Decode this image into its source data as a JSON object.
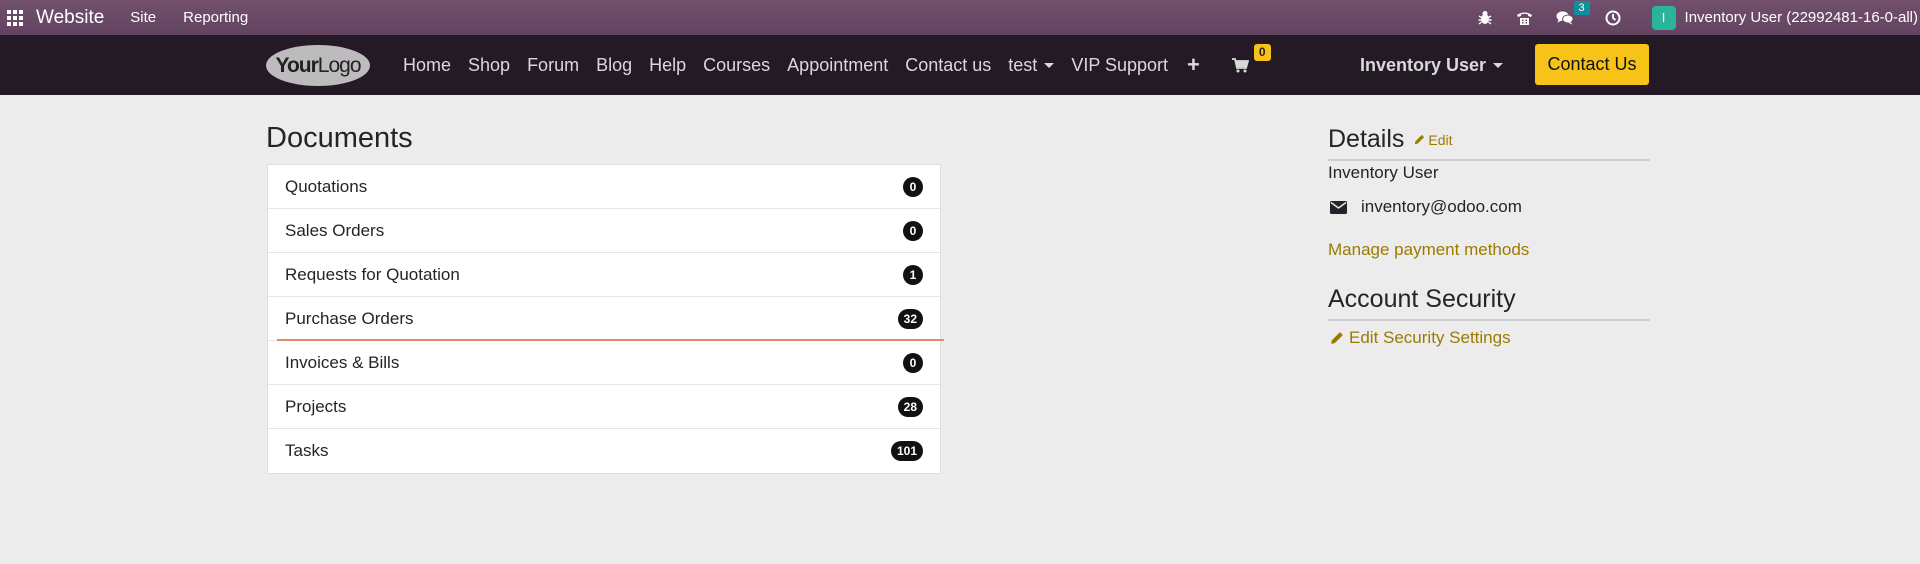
{
  "admin_bar": {
    "brand": "Website",
    "menu": [
      "Site",
      "Reporting"
    ],
    "chat_count": "3",
    "user_initial": "I",
    "user": "Inventory User (22992481-16-0-all)"
  },
  "navbar": {
    "logo_part1": "Your",
    "logo_part2": "Logo",
    "links": [
      "Home",
      "Shop",
      "Forum",
      "Blog",
      "Help",
      "Courses",
      "Appointment",
      "Contact us"
    ],
    "dropdown": "test",
    "vip": "VIP Support",
    "cart_count": "0",
    "user": "Inventory User",
    "contact_button": "Contact Us"
  },
  "documents": {
    "title": "Documents",
    "items": [
      {
        "label": "Quotations",
        "count": "0"
      },
      {
        "label": "Sales Orders",
        "count": "0"
      },
      {
        "label": "Requests for Quotation",
        "count": "1"
      },
      {
        "label": "Purchase Orders",
        "count": "32"
      },
      {
        "label": "Invoices & Bills",
        "count": "0"
      },
      {
        "label": "Projects",
        "count": "28"
      },
      {
        "label": "Tasks",
        "count": "101"
      }
    ]
  },
  "details": {
    "title": "Details",
    "edit": "Edit",
    "name": "Inventory User",
    "email": "inventory@odoo.com",
    "payment_link": "Manage payment methods"
  },
  "security": {
    "title": "Account Security",
    "edit_link": "Edit Security Settings"
  }
}
